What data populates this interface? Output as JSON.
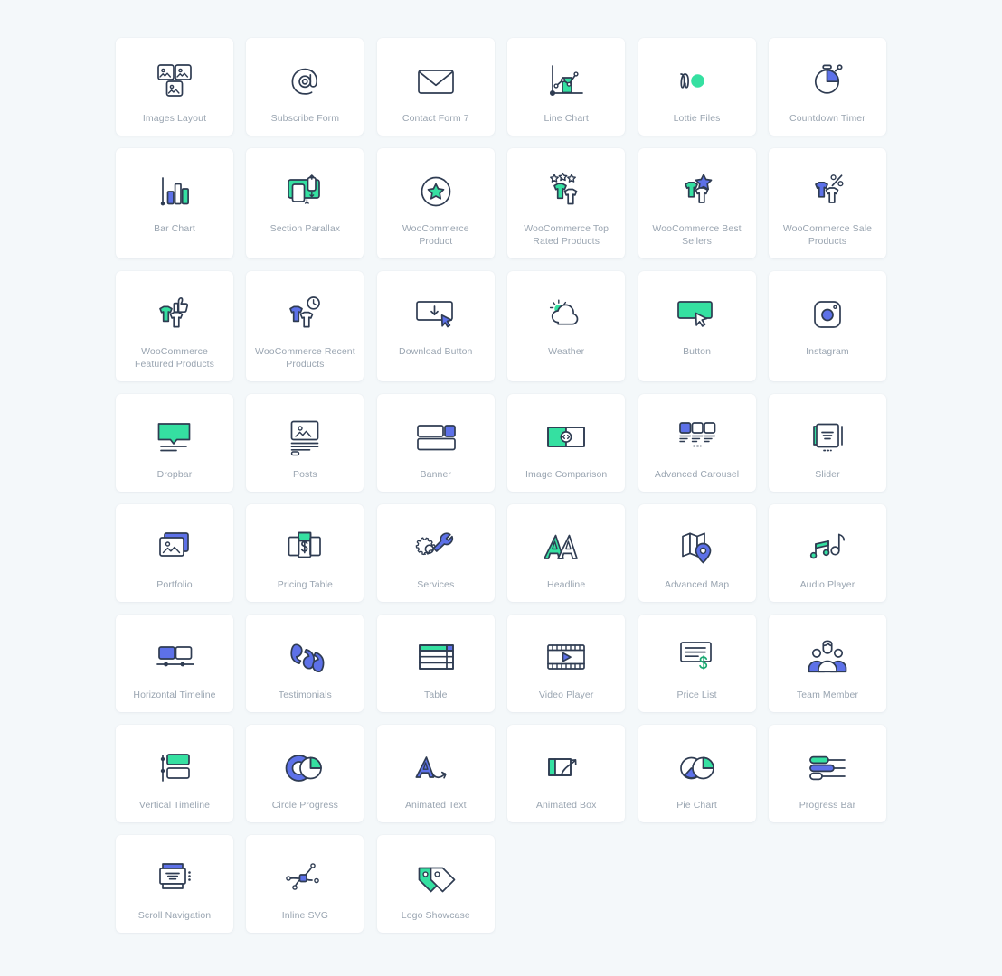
{
  "page": {
    "background_color": "#f4f8fa",
    "card_color": "#ffffff",
    "label_color": "#9aa5b1",
    "icon_stroke_color": "#2f3c52",
    "accent_green": "#35e0a1",
    "accent_blue": "#5d71e8",
    "columns": 6
  },
  "widgets": [
    {
      "label": "Images Layout",
      "icon": "images-layout-icon"
    },
    {
      "label": "Subscribe Form",
      "icon": "at-sign-icon"
    },
    {
      "label": "Contact Form 7",
      "icon": "envelope-icon"
    },
    {
      "label": "Line Chart",
      "icon": "line-chart-icon"
    },
    {
      "label": "Lottie Files",
      "icon": "lottie-files-icon"
    },
    {
      "label": "Countdown Timer",
      "icon": "stopwatch-icon"
    },
    {
      "label": "Bar Chart",
      "icon": "bar-chart-icon"
    },
    {
      "label": "Section Parallax",
      "icon": "section-parallax-icon"
    },
    {
      "label": "WooCommerce Product",
      "icon": "star-in-circle-icon"
    },
    {
      "label": "WooCommerce Top Rated Products",
      "icon": "shirts-three-stars-icon"
    },
    {
      "label": "WooCommerce Best Sellers",
      "icon": "shirts-star-icon"
    },
    {
      "label": "WooCommerce Sale Products",
      "icon": "shirts-percent-icon"
    },
    {
      "label": "WooCommerce Featured Products",
      "icon": "shirts-thumbs-up-icon"
    },
    {
      "label": "WooCommerce Recent Products",
      "icon": "shirts-clock-icon"
    },
    {
      "label": "Download Button",
      "icon": "download-button-icon"
    },
    {
      "label": "Weather",
      "icon": "sun-cloud-icon"
    },
    {
      "label": "Button",
      "icon": "button-cursor-icon"
    },
    {
      "label": "Instagram",
      "icon": "instagram-icon"
    },
    {
      "label": "Dropbar",
      "icon": "dropbar-icon"
    },
    {
      "label": "Posts",
      "icon": "posts-icon"
    },
    {
      "label": "Banner",
      "icon": "banner-icon"
    },
    {
      "label": "Image Comparison",
      "icon": "image-comparison-icon"
    },
    {
      "label": "Advanced Carousel",
      "icon": "advanced-carousel-icon"
    },
    {
      "label": "Slider",
      "icon": "slider-icon"
    },
    {
      "label": "Portfolio",
      "icon": "portfolio-icon"
    },
    {
      "label": "Pricing Table",
      "icon": "pricing-table-icon"
    },
    {
      "label": "Services",
      "icon": "gear-wrench-icon"
    },
    {
      "label": "Headline",
      "icon": "double-a-icon"
    },
    {
      "label": "Advanced Map",
      "icon": "map-pin-icon"
    },
    {
      "label": "Audio Player",
      "icon": "music-notes-icon"
    },
    {
      "label": "Horizontal Timeline",
      "icon": "horizontal-timeline-icon"
    },
    {
      "label": "Testimonials",
      "icon": "quote-marks-icon"
    },
    {
      "label": "Table",
      "icon": "table-icon"
    },
    {
      "label": "Video Player",
      "icon": "film-play-icon"
    },
    {
      "label": "Price List",
      "icon": "price-list-icon"
    },
    {
      "label": "Team Member",
      "icon": "team-member-icon"
    },
    {
      "label": "Vertical Timeline",
      "icon": "vertical-timeline-icon"
    },
    {
      "label": "Circle Progress",
      "icon": "circle-progress-icon"
    },
    {
      "label": "Animated Text",
      "icon": "animated-text-icon"
    },
    {
      "label": "Animated Box",
      "icon": "animated-box-icon"
    },
    {
      "label": "Pie Chart",
      "icon": "pie-chart-icon"
    },
    {
      "label": "Progress Bar",
      "icon": "progress-bar-icon"
    },
    {
      "label": "Scroll Navigation",
      "icon": "scroll-navigation-icon"
    },
    {
      "label": "Inline SVG",
      "icon": "inline-svg-icon"
    },
    {
      "label": "Logo Showcase",
      "icon": "tags-icon"
    }
  ]
}
